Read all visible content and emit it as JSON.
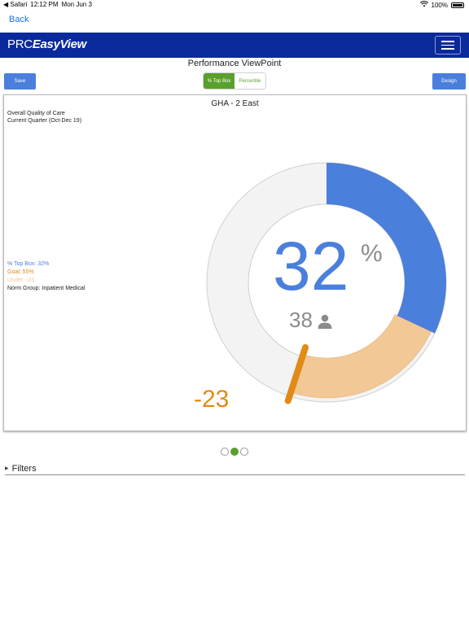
{
  "status_bar": {
    "carrier": "◀ Safari",
    "time": "12:12 PM",
    "date": "Mon Jun 3",
    "battery": "100%"
  },
  "nav": {
    "back_label": "Back"
  },
  "header": {
    "logo_prefix": "PRC",
    "logo_suffix": "EasyView"
  },
  "page": {
    "title": "Performance ViewPoint"
  },
  "toolbar": {
    "save_label": "Save",
    "design_label": "Design",
    "toggle": {
      "active_label": "% Top Box",
      "inactive_label": "Percentile"
    }
  },
  "card": {
    "title": "GHA - 2 East",
    "measure": "Overall Quality of Care",
    "period": "Current Quarter (Oct-Dec 19)",
    "legend": {
      "top_box": "% Top Box: 32%",
      "goal": "Goal: 55%",
      "under": "Under: -23",
      "norm_group": "Norm Group: Inpatient Medical"
    },
    "gauge": {
      "value": "32",
      "percent_sign": "%",
      "count": "38",
      "difference": "-23",
      "top_box_pct": 32,
      "goal_pct": 55
    }
  },
  "pager": {
    "pages": 3,
    "active_index": 1
  },
  "filters": {
    "label": "Filters"
  },
  "colors": {
    "header_blue": "#0a2a9c",
    "button_blue": "#4a7fdc",
    "toggle_green": "#5aa02c",
    "goal_orange": "#e28a17",
    "under_peach": "#f1c896",
    "ring_gray": "#f3f3f3"
  },
  "icons": {
    "person": "person-icon",
    "filters_caret": "caret-right-icon",
    "menu": "hamburger-icon"
  }
}
